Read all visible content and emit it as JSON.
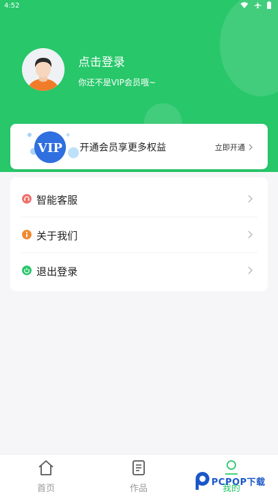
{
  "status_bar": {
    "time": "4:52",
    "icons": [
      "wifi-icon",
      "airplane-icon",
      "battery-icon"
    ]
  },
  "colors": {
    "primary": "#27c76a",
    "service_icon": "#f0706a",
    "about_icon": "#f08a32",
    "logout_icon": "#27c76a",
    "vip_blue": "#2f6fe0"
  },
  "profile": {
    "login_label": "点击登录",
    "subtitle": "你还不是VIP会员哦~"
  },
  "vip": {
    "badge": "VIP",
    "text": "开通会员享更多权益",
    "action": "立即开通"
  },
  "menu": [
    {
      "label": "智能客服",
      "icon": "headset-icon"
    },
    {
      "label": "关于我们",
      "icon": "info-icon"
    },
    {
      "label": "退出登录",
      "icon": "power-icon"
    }
  ],
  "tabbar": [
    {
      "label": "首页",
      "icon": "home-icon"
    },
    {
      "label": "作品",
      "icon": "document-icon"
    },
    {
      "label": "我的",
      "icon": "profile-icon"
    }
  ],
  "watermark": {
    "text": "PCPOP下载"
  }
}
